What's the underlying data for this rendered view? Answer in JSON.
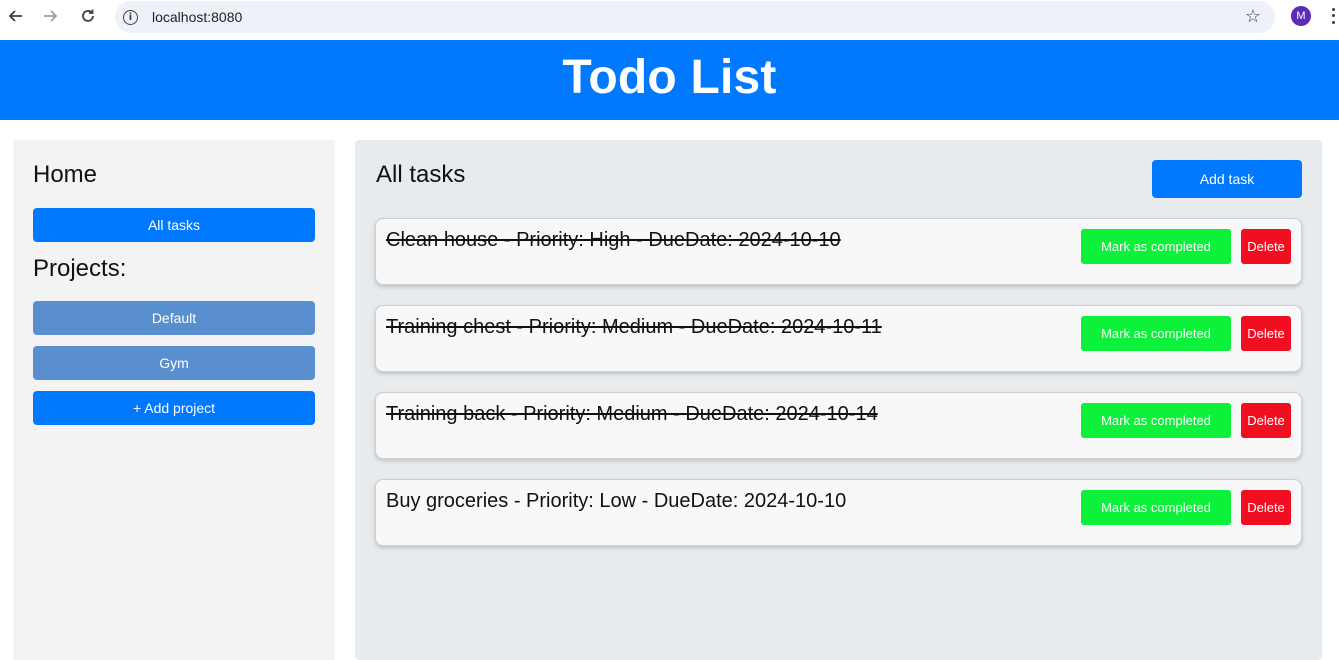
{
  "browser": {
    "url": "localhost:8080",
    "profile_initial": "M",
    "icons": {
      "back": "back-arrow-icon",
      "forward": "forward-arrow-icon",
      "reload": "reload-icon",
      "site_info": "info-icon",
      "bookmark": "star-icon",
      "menu": "kebab-menu-icon"
    }
  },
  "header": {
    "title": "Todo List",
    "color": "#0079ff"
  },
  "sidebar": {
    "home_label": "Home",
    "all_tasks_label": "All tasks",
    "projects_label": "Projects:",
    "projects": [
      {
        "label": "Default"
      },
      {
        "label": "Gym"
      }
    ],
    "add_project_label": "+ Add project"
  },
  "main": {
    "title": "All tasks",
    "add_task_label": "Add task",
    "tasks": [
      {
        "text": "Clean house - Priority: High - DueDate: 2024-10-10",
        "completed": true,
        "complete_label": "Mark as completed",
        "delete_label": "Delete"
      },
      {
        "text": "Training chest - Priority: Medium - DueDate: 2024-10-11",
        "completed": true,
        "complete_label": "Mark as completed",
        "delete_label": "Delete"
      },
      {
        "text": "Training back - Priority: Medium - DueDate: 2024-10-14",
        "completed": true,
        "complete_label": "Mark as completed",
        "delete_label": "Delete"
      },
      {
        "text": "Buy groceries - Priority: Low - DueDate: 2024-10-10",
        "completed": false,
        "complete_label": "Mark as completed",
        "delete_label": "Delete"
      }
    ]
  },
  "colors": {
    "primary": "#0079ff",
    "project_button": "#5a8fcf",
    "complete_button": "#0df13b",
    "delete_button": "#f00f21"
  }
}
